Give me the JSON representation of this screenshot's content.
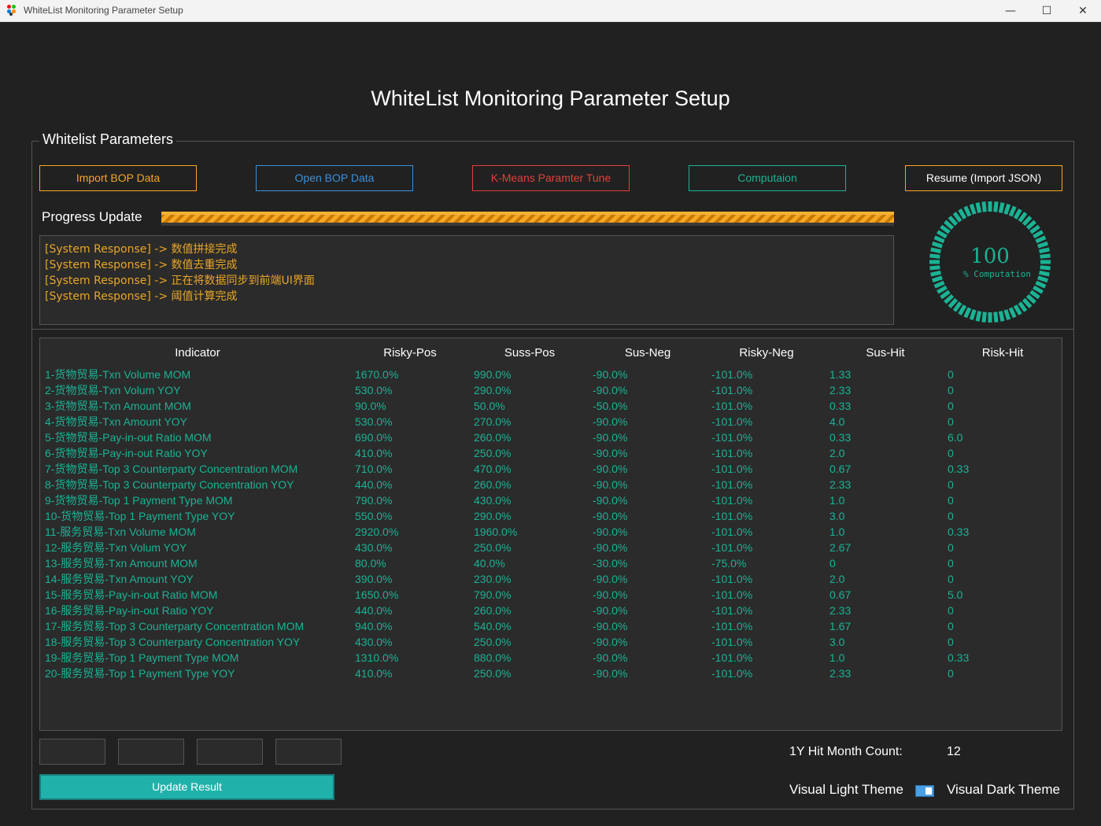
{
  "window": {
    "title": "WhiteList Monitoring Parameter Setup",
    "minimize": "—",
    "maximize": "☐",
    "close": "✕"
  },
  "page_title": "WhiteList Monitoring Parameter Setup",
  "group_title": "Whitelist Parameters",
  "buttons": {
    "import_bop": "Import BOP Data",
    "open_bop": "Open BOP Data",
    "kmeans": "K-Means Paramter Tune",
    "computation": "Computaion",
    "resume": "Resume (Import JSON)"
  },
  "progress": {
    "label": "Progress Update",
    "fraction": 1.0
  },
  "log": [
    "[System Response] -> 数值拼接完成",
    "[System Response] -> 数值去重完成",
    "[System Response] -> 正在将数据同步到前端UI界面",
    "[System Response] -> 阈值计算完成"
  ],
  "gauge": {
    "value": "100",
    "label": "% Computation",
    "fraction": 1.0
  },
  "table": {
    "headers": [
      "Indicator",
      "Risky-Pos",
      "Suss-Pos",
      "Sus-Neg",
      "Risky-Neg",
      "Sus-Hit",
      "Risk-Hit"
    ],
    "rows": [
      [
        "1-货物贸易-Txn Volume MOM",
        "1670.0%",
        "990.0%",
        "-90.0%",
        "-101.0%",
        "1.33",
        "0"
      ],
      [
        "2-货物贸易-Txn Volum YOY",
        "530.0%",
        "290.0%",
        "-90.0%",
        "-101.0%",
        "2.33",
        "0"
      ],
      [
        "3-货物贸易-Txn Amount MOM",
        "90.0%",
        "50.0%",
        "-50.0%",
        "-101.0%",
        "0.33",
        "0"
      ],
      [
        "4-货物贸易-Txn Amount YOY",
        "530.0%",
        "270.0%",
        "-90.0%",
        "-101.0%",
        "4.0",
        "0"
      ],
      [
        "5-货物贸易-Pay-in-out Ratio MOM",
        "690.0%",
        "260.0%",
        "-90.0%",
        "-101.0%",
        "0.33",
        "6.0"
      ],
      [
        "6-货物贸易-Pay-in-out Ratio YOY",
        "410.0%",
        "250.0%",
        "-90.0%",
        "-101.0%",
        "2.0",
        "0"
      ],
      [
        "7-货物贸易-Top 3 Counterparty Concentration MOM",
        "710.0%",
        "470.0%",
        "-90.0%",
        "-101.0%",
        "0.67",
        "0.33"
      ],
      [
        "8-货物贸易-Top 3 Counterparty Concentration YOY",
        "440.0%",
        "260.0%",
        "-90.0%",
        "-101.0%",
        "2.33",
        "0"
      ],
      [
        "9-货物贸易-Top 1 Payment Type MOM",
        "790.0%",
        "430.0%",
        "-90.0%",
        "-101.0%",
        "1.0",
        "0"
      ],
      [
        "10-货物贸易-Top 1 Payment Type YOY",
        "550.0%",
        "290.0%",
        "-90.0%",
        "-101.0%",
        "3.0",
        "0"
      ],
      [
        "11-服务贸易-Txn Volume MOM",
        "2920.0%",
        "1960.0%",
        "-90.0%",
        "-101.0%",
        "1.0",
        "0.33"
      ],
      [
        "12-服务贸易-Txn Volum YOY",
        "430.0%",
        "250.0%",
        "-90.0%",
        "-101.0%",
        "2.67",
        "0"
      ],
      [
        "13-服务贸易-Txn Amount MOM",
        "80.0%",
        "40.0%",
        "-30.0%",
        "-75.0%",
        "0",
        "0"
      ],
      [
        "14-服务贸易-Txn Amount YOY",
        "390.0%",
        "230.0%",
        "-90.0%",
        "-101.0%",
        "2.0",
        "0"
      ],
      [
        "15-服务贸易-Pay-in-out Ratio MOM",
        "1650.0%",
        "790.0%",
        "-90.0%",
        "-101.0%",
        "0.67",
        "5.0"
      ],
      [
        "16-服务贸易-Pay-in-out Ratio YOY",
        "440.0%",
        "260.0%",
        "-90.0%",
        "-101.0%",
        "2.33",
        "0"
      ],
      [
        "17-服务贸易-Top 3 Counterparty Concentration MOM",
        "940.0%",
        "540.0%",
        "-90.0%",
        "-101.0%",
        "1.67",
        "0"
      ],
      [
        "18-服务贸易-Top 3 Counterparty Concentration YOY",
        "430.0%",
        "250.0%",
        "-90.0%",
        "-101.0%",
        "3.0",
        "0"
      ],
      [
        "19-服务贸易-Top 1 Payment Type MOM",
        "1310.0%",
        "880.0%",
        "-90.0%",
        "-101.0%",
        "1.0",
        "0.33"
      ],
      [
        "20-服务贸易-Top 1 Payment Type YOY",
        "410.0%",
        "250.0%",
        "-90.0%",
        "-101.0%",
        "2.33",
        "0"
      ]
    ]
  },
  "inputs": [
    "",
    "",
    "",
    ""
  ],
  "update_button": "Update Result",
  "hit_month": {
    "label": "1Y Hit Month Count:",
    "value": "12"
  },
  "theme": {
    "light_label": "Visual Light Theme",
    "dark_label": "Visual Dark Theme",
    "toggle_on": true
  },
  "colors": {
    "background": "#212121",
    "accent_teal": "#1ab394",
    "log_text": "#e8a628",
    "import_bop_border": "#f5a623",
    "open_bop_border": "#3b8fd9",
    "kmeans_border": "#e0413b",
    "computation_border": "#1ab394",
    "resume_border": "#f5a623",
    "update_button_bg": "#20b2aa"
  }
}
